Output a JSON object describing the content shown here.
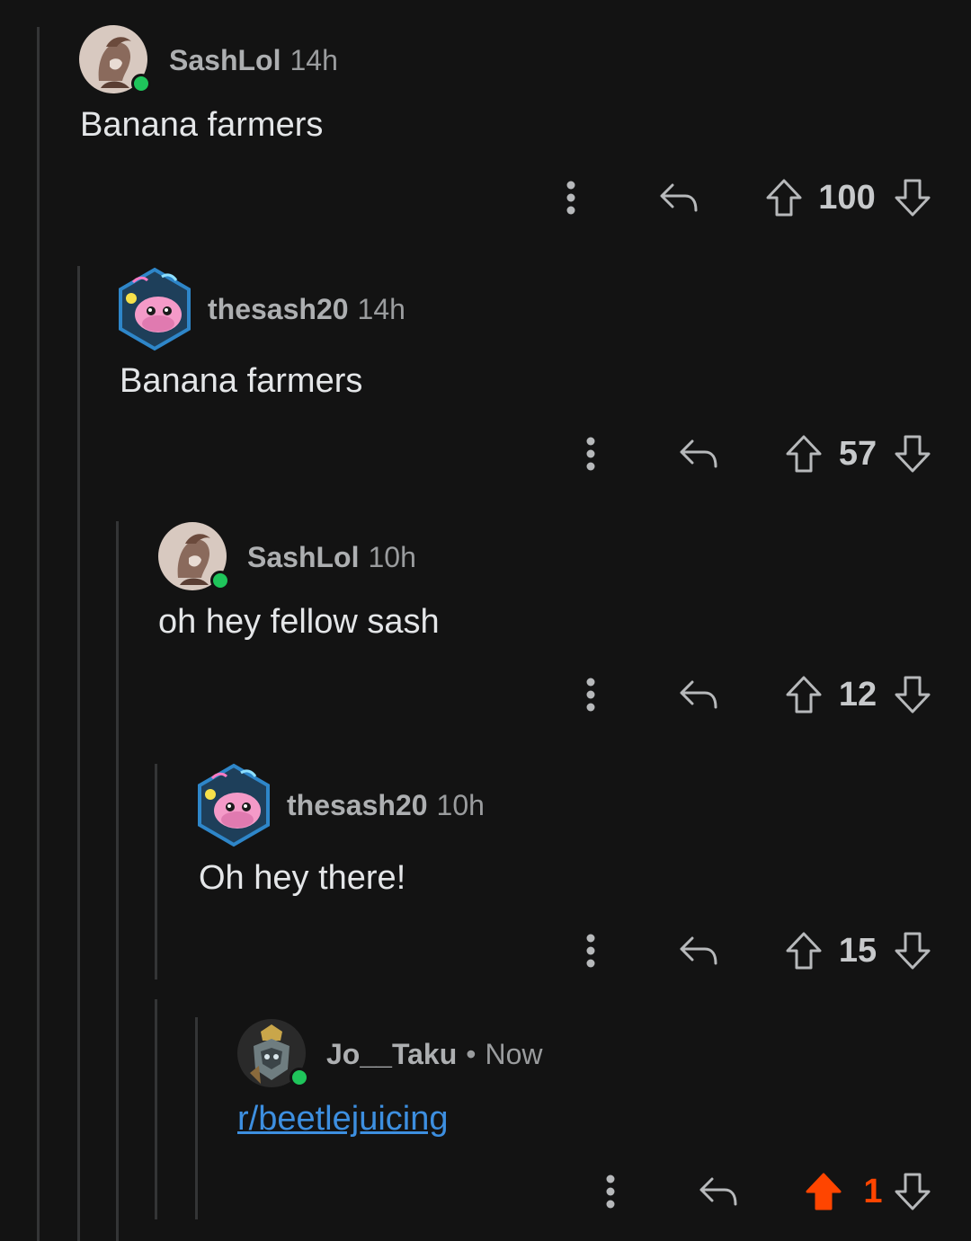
{
  "colors": {
    "background": "#131313",
    "thread_line": "#343536",
    "online": "#1fc55b",
    "upvote_active": "#ff4500",
    "link": "#3d8fe0"
  },
  "comments": [
    {
      "username": "SashLol",
      "time": "14h",
      "body": "Banana farmers",
      "score": "100",
      "avatar": "sketch-avatar",
      "online": true
    },
    {
      "username": "thesash20",
      "time": "14h",
      "body": "Banana farmers",
      "score": "57",
      "avatar": "blobfish-avatar",
      "online": false
    },
    {
      "username": "SashLol",
      "time": "10h",
      "body": "oh hey fellow sash",
      "score": "12",
      "avatar": "sketch-avatar",
      "online": true
    },
    {
      "username": "thesash20",
      "time": "10h",
      "body": "Oh hey there!",
      "score": "15",
      "avatar": "blobfish-avatar",
      "online": false
    },
    {
      "username": "Jo__Taku",
      "separator": "•",
      "time": "Now",
      "body": "r/beetlejuicing",
      "score": "1",
      "avatar": "armored-knight-avatar",
      "online": true,
      "upvoted": true
    }
  ],
  "icons": {
    "more": "more-vertical-icon",
    "reply": "reply-arrow-icon",
    "upvote": "upvote-arrow-icon",
    "downvote": "downvote-arrow-icon"
  }
}
